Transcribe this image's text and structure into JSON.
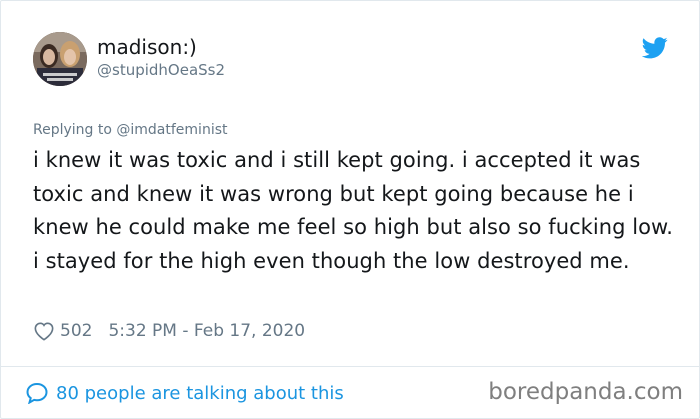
{
  "user": {
    "display_name": "madison:)",
    "handle": "@stupidhOeaSs2"
  },
  "tweet": {
    "reply_prefix": "Replying to ",
    "reply_to": "@imdatfeminist",
    "text": "i knew it was toxic and i still kept going. i accepted it was toxic and knew it was wrong but kept going because he i knew he could make me feel so high but also so fucking low. i stayed for the high even though the low destroyed me.",
    "likes": "502",
    "timestamp": "5:32 PM - Feb 17, 2020"
  },
  "footer": {
    "talking": "80 people are talking about this",
    "watermark": "boredpanda.com"
  },
  "colors": {
    "twitter_blue": "#1da1f2",
    "link_blue": "#1b95e0",
    "secondary_text": "#657786",
    "primary_text": "#14171a"
  },
  "icons": {
    "brand": "twitter-bird-icon",
    "like": "heart-outline-icon",
    "conversation": "speech-bubble-icon"
  }
}
